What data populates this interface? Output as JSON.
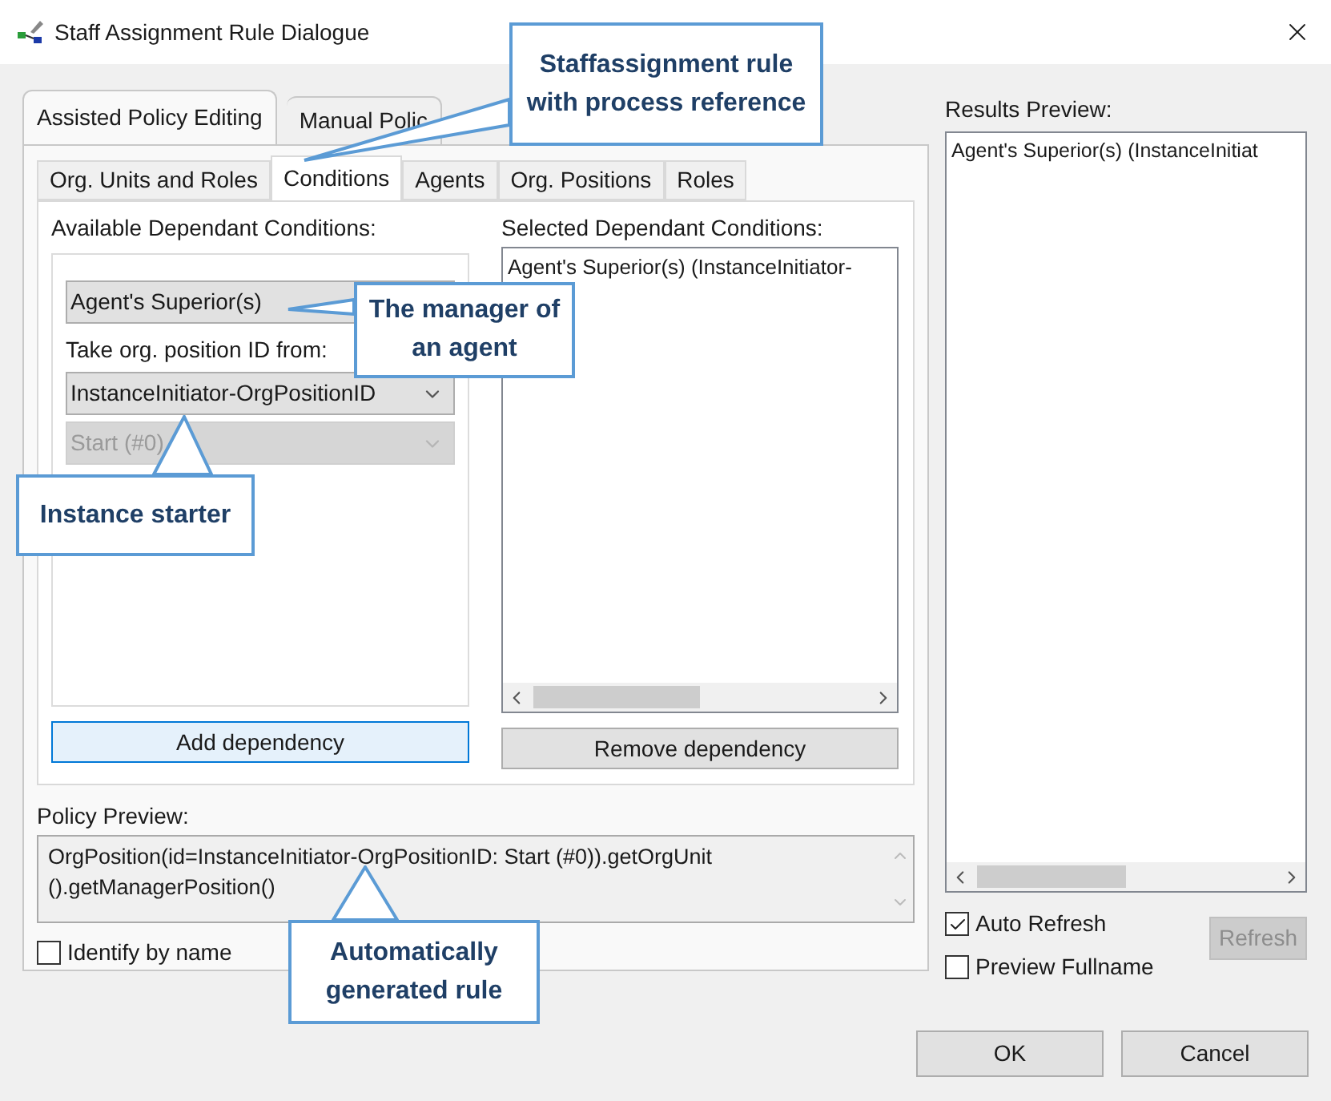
{
  "window": {
    "title": "Staff Assignment Rule Dialogue"
  },
  "main_tabs": [
    {
      "label": "Assisted Policy Editing",
      "selected": true
    },
    {
      "label": "Manual Polic",
      "selected": false
    }
  ],
  "sub_tabs": [
    {
      "label": "Org. Units and Roles",
      "selected": false
    },
    {
      "label": "Conditions",
      "selected": true
    },
    {
      "label": "Agents",
      "selected": false
    },
    {
      "label": "Org. Positions",
      "selected": false
    },
    {
      "label": "Roles",
      "selected": false
    }
  ],
  "available": {
    "label": "Available Dependant Conditions:",
    "condition": {
      "value": "Agent's Superior(s)",
      "disabled": false
    },
    "position_label": "Take org. position ID from:",
    "position_source": {
      "value": "InstanceInitiator-OrgPositionID",
      "disabled": false
    },
    "activity": {
      "value": "Start (#0)",
      "disabled": true
    }
  },
  "selected_conditions": {
    "label": "Selected Dependant Conditions:",
    "items": [
      "Agent's Superior(s) (InstanceInitiator-"
    ]
  },
  "buttons": [
    {
      "label": "Add dependency",
      "focused": true
    },
    {
      "label": "Remove dependency",
      "focused": false
    }
  ],
  "policy_preview": {
    "label": "Policy Preview:",
    "lines": [
      "OrgPosition(id=InstanceInitiator-OrgPositionID: Start (#0)).getOrgUnit",
      "().getManagerPosition()"
    ]
  },
  "identify_by_name": {
    "label": "Identify by name",
    "checked": false
  },
  "results_preview": {
    "label": "Results Preview:",
    "items": [
      "Agent's Superior(s) (InstanceInitiat"
    ]
  },
  "auto_refresh": {
    "label": "Auto Refresh",
    "checked": true
  },
  "preview_fullname": {
    "label": "Preview Fullname",
    "checked": false
  },
  "refresh_button": {
    "label": "Refresh",
    "disabled": true
  },
  "footer_buttons": [
    "OK",
    "Cancel"
  ],
  "callouts": [
    "Staffassignment rule with process reference",
    "The manager of an agent",
    "Instance starter",
    "Automatically generated rule"
  ]
}
